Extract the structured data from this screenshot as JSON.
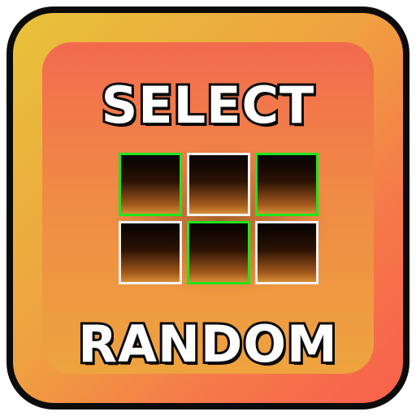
{
  "title_top": "SELECT",
  "title_bottom": "RANDOM",
  "grid": {
    "rows": 2,
    "cols": 3,
    "cells": [
      {
        "row": 0,
        "col": 0,
        "selected": true
      },
      {
        "row": 0,
        "col": 1,
        "selected": false
      },
      {
        "row": 0,
        "col": 2,
        "selected": true
      },
      {
        "row": 1,
        "col": 0,
        "selected": false
      },
      {
        "row": 1,
        "col": 1,
        "selected": true
      },
      {
        "row": 1,
        "col": 2,
        "selected": false
      }
    ]
  },
  "colors": {
    "selected_border": "#1ee61e",
    "unselected_border": "#f2f2f2",
    "outline": "#0b0b0b",
    "frame_gradient_start": "#e8c23a",
    "frame_gradient_end": "#f8604c"
  }
}
